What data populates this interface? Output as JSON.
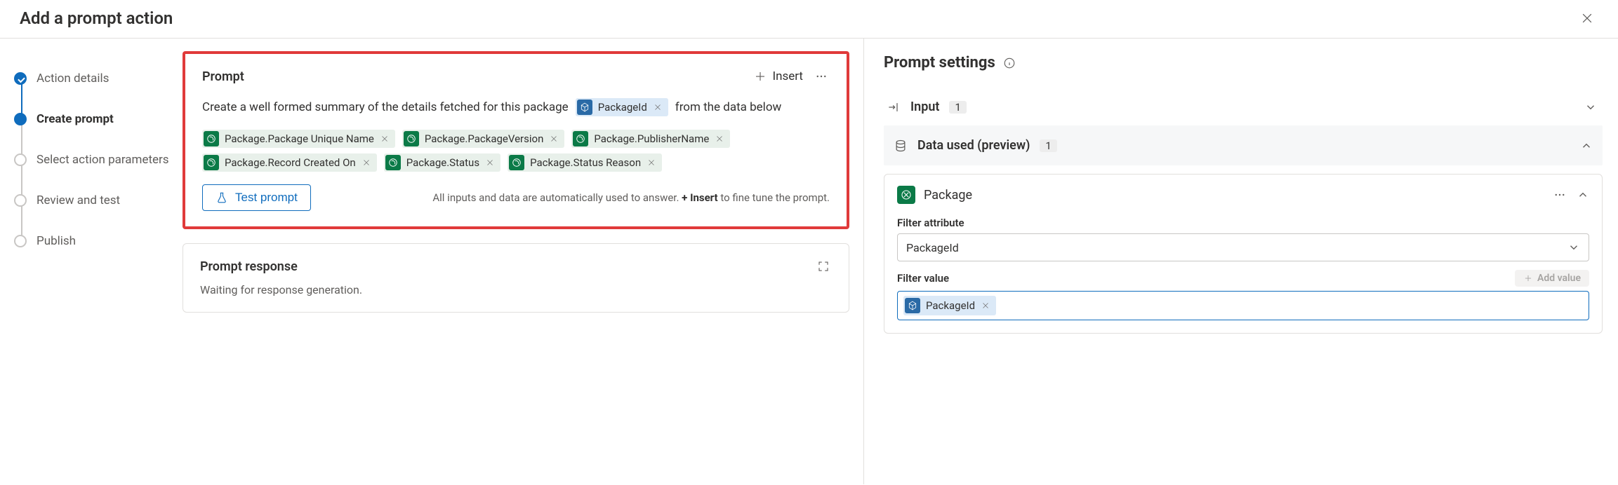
{
  "header": {
    "title": "Add a prompt action"
  },
  "steps": [
    {
      "label": "Action details",
      "state": "done"
    },
    {
      "label": "Create prompt",
      "state": "active"
    },
    {
      "label": "Select action parameters",
      "state": "pending"
    },
    {
      "label": "Review and test",
      "state": "pending"
    },
    {
      "label": "Publish",
      "state": "pending"
    }
  ],
  "prompt": {
    "title": "Prompt",
    "insert_label": "Insert",
    "text_before_token": "Create a well formed summary of the details fetched for this package",
    "inline_token": "PackageId",
    "text_after_token": "from the data below",
    "tokens": [
      "Package.Package Unique Name",
      "Package.PackageVersion",
      "Package.PublisherName",
      "Package.Record Created On",
      "Package.Status",
      "Package.Status Reason"
    ],
    "test_label": "Test prompt",
    "hint_before": "All inputs and data are automatically used to answer. ",
    "hint_bold": "+ Insert",
    "hint_after": " to fine tune the prompt."
  },
  "response": {
    "title": "Prompt response",
    "body": "Waiting for response generation."
  },
  "right": {
    "title": "Prompt settings",
    "input_label": "Input",
    "input_count": "1",
    "data_used_label": "Data used (preview)",
    "data_used_count": "1",
    "package_label": "Package",
    "filter_attribute_label": "Filter attribute",
    "filter_attribute_value": "PackageId",
    "filter_value_label": "Filter value",
    "add_value_label": "Add value",
    "filter_value_token": "PackageId"
  }
}
